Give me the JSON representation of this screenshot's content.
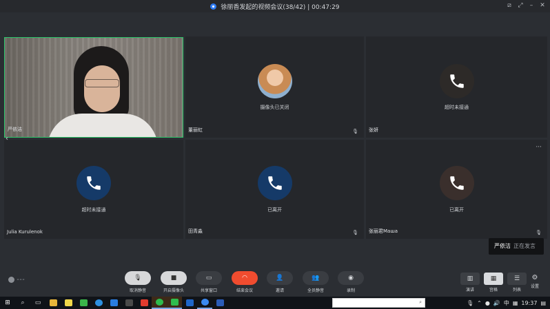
{
  "window": {
    "title": "徐丽香发起的视频会议(38/42)",
    "timer": "00:47:29"
  },
  "tiles": [
    {
      "name": "严依洁",
      "status": "",
      "type": "video"
    },
    {
      "name": "董丽虹",
      "status": "摄像头已关闭",
      "type": "avatar"
    },
    {
      "name": "张妍",
      "status": "超时未接通",
      "type": "phone"
    },
    {
      "name": "Julia Kurulenok",
      "status": "超时未接通",
      "type": "phone"
    },
    {
      "name": "田青淼",
      "status": "已离开",
      "type": "phone"
    },
    {
      "name": "张丽君Маша",
      "status": "已离开",
      "type": "phone"
    }
  ],
  "toast": {
    "name": "严依洁",
    "text": "正在发言"
  },
  "toolbar": {
    "unmute": "取消静音",
    "camera": "开启摄像头",
    "share": "共享窗口",
    "end": "结束会议",
    "invite": "邀请",
    "muteall": "全员静音",
    "record": "录制"
  },
  "views": {
    "speaker": "演讲",
    "grid": "宫格",
    "list": "列表",
    "settings": "设置"
  },
  "taskbar": {
    "time": "19:37",
    "ime": "中"
  },
  "colors": {
    "accent_green": "#2cc96b",
    "end_red": "#f04c2f",
    "phone_blue": "#153a68"
  }
}
